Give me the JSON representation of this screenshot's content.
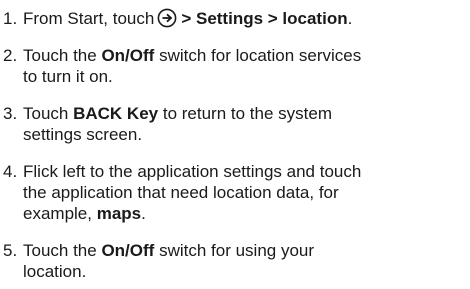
{
  "steps": [
    {
      "number": "1.",
      "pre": "From Start, touch",
      "icon": "circled-arrow-right-icon",
      "strong": "> Settings > location",
      "post": "."
    },
    {
      "number": "2.",
      "pre": "Touch the ",
      "strong": "On/Off",
      "post": " switch for location services",
      "line2": "to turn it on."
    },
    {
      "number": "3.",
      "pre": "Touch ",
      "strong": "BACK Key",
      "post": " to return to the system",
      "line2": "settings screen."
    },
    {
      "number": "4.",
      "line1": "Flick left to the application settings and touch",
      "line2": "the application that need location data, for",
      "pre3": "example, ",
      "strong3": "maps",
      "post3": "."
    },
    {
      "number": "5.",
      "pre": "Touch the ",
      "strong": "On/Off",
      "post": " switch for using your",
      "line2": "location."
    }
  ]
}
